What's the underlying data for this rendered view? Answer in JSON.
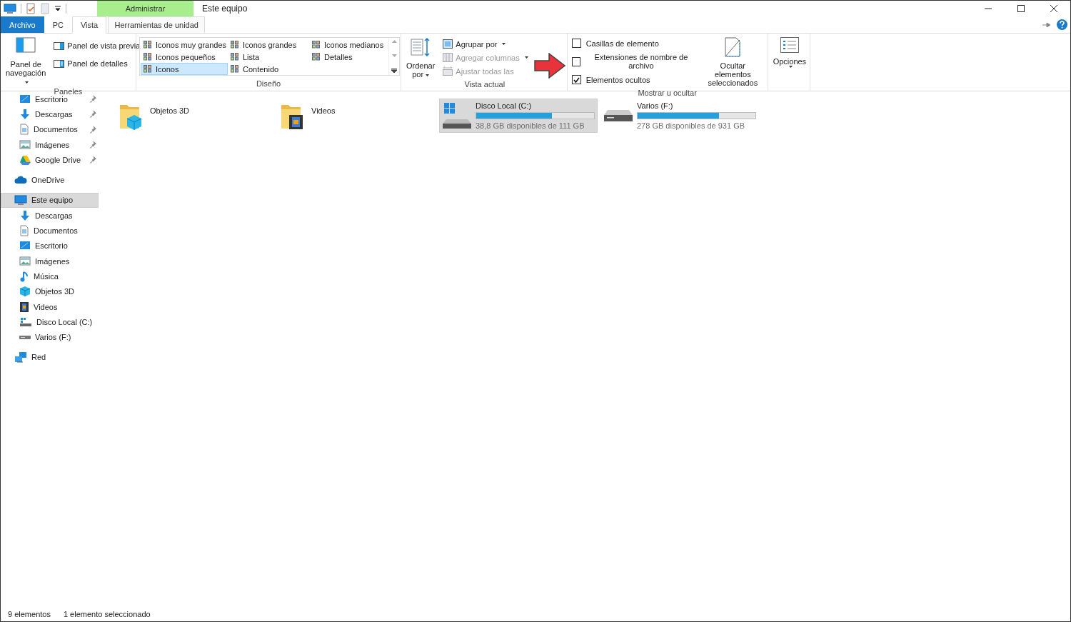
{
  "title_bar": {
    "context_tab": "Administrar",
    "title": "Este equipo"
  },
  "tabs": [
    {
      "label": "Archivo",
      "kind": "file",
      "selected": false
    },
    {
      "label": "PC",
      "kind": "tab",
      "selected": false
    },
    {
      "label": "Vista",
      "kind": "tab",
      "selected": true
    },
    {
      "label": "Herramientas de unidad",
      "kind": "context",
      "selected": false
    }
  ],
  "ribbon": {
    "paneles": {
      "title": "Paneles",
      "nav_pane": [
        "Panel de",
        "navegación"
      ],
      "buttons": [
        {
          "label": "Panel de vista previa",
          "kind": "preview"
        },
        {
          "label": "Panel de detalles",
          "kind": "details"
        }
      ]
    },
    "diseno": {
      "title": "Diseño",
      "layouts": [
        {
          "label": "Iconos muy grandes",
          "selected": false
        },
        {
          "label": "Iconos grandes",
          "selected": false
        },
        {
          "label": "Iconos medianos",
          "selected": false
        },
        {
          "label": "Iconos pequeños",
          "selected": false
        },
        {
          "label": "Lista",
          "selected": false
        },
        {
          "label": "Detalles",
          "selected": false
        },
        {
          "label": "Iconos",
          "selected": true
        },
        {
          "label": "Contenido",
          "selected": false
        }
      ]
    },
    "vista_actual": {
      "title": "Vista actual",
      "sort": [
        "Ordenar",
        "por"
      ],
      "items": [
        {
          "label": "Agrupar por",
          "kind": "group",
          "disabled": false
        },
        {
          "label": "Agregar columnas",
          "kind": "columns",
          "disabled": true
        },
        {
          "label": "Ajustar todas las",
          "kind": "fit",
          "disabled": true
        }
      ]
    },
    "mostrar": {
      "title": "Mostrar u ocultar",
      "checks": [
        {
          "label": "Casillas de elemento",
          "checked": false
        },
        {
          "label": "Extensiones de nombre de archivo",
          "checked": false
        },
        {
          "label": "Elementos ocultos",
          "checked": true
        }
      ],
      "hide_button": [
        "Ocultar elementos",
        "seleccionados"
      ]
    },
    "opciones": {
      "label": "Opciones"
    }
  },
  "sidebar": {
    "quick_access_children": [
      {
        "label": "Escritorio",
        "kind": "desktop",
        "pinned": true
      },
      {
        "label": "Descargas",
        "kind": "download",
        "pinned": true
      },
      {
        "label": "Documentos",
        "kind": "document",
        "pinned": true
      },
      {
        "label": "Imágenes",
        "kind": "image",
        "pinned": true
      },
      {
        "label": "Google Drive",
        "kind": "gdrive",
        "pinned": true
      }
    ],
    "items": [
      {
        "label": "OneDrive",
        "kind": "cloud",
        "selected": false
      },
      {
        "label": "Este equipo",
        "kind": "pc",
        "selected": true,
        "children": [
          {
            "label": "Descargas",
            "kind": "download",
            "selected": false
          },
          {
            "label": "Documentos",
            "kind": "document",
            "selected": false
          },
          {
            "label": "Escritorio",
            "kind": "desktop",
            "selected": false
          },
          {
            "label": "Imágenes",
            "kind": "image",
            "selected": false
          },
          {
            "label": "Música",
            "kind": "music",
            "selected": false
          },
          {
            "label": "Objetos 3D",
            "kind": "cube",
            "selected": false
          },
          {
            "label": "Videos",
            "kind": "film",
            "selected": false
          },
          {
            "label": "Disco Local (C:)",
            "kind": "sysdrive",
            "selected": false
          },
          {
            "label": "Varios (F:)",
            "kind": "drive",
            "selected": false
          }
        ]
      },
      {
        "label": "Red",
        "kind": "network",
        "selected": false
      }
    ]
  },
  "content": {
    "items": [
      {
        "kind": "folder3d",
        "label": "Objetos 3D"
      },
      {
        "kind": "foldervideo",
        "label": "Videos"
      },
      {
        "kind": "sysdrive",
        "label": "Disco Local (C:)",
        "level": 0.64,
        "free": "38,8 GB disponibles de 111 GB",
        "selected": true
      },
      {
        "kind": "drive",
        "label": "Varios (F:)",
        "level": 0.69,
        "free": "278 GB disponibles de 931 GB",
        "selected": false
      }
    ]
  },
  "status_bar": [
    "9 elementos",
    "1 elemento seleccionado"
  ]
}
